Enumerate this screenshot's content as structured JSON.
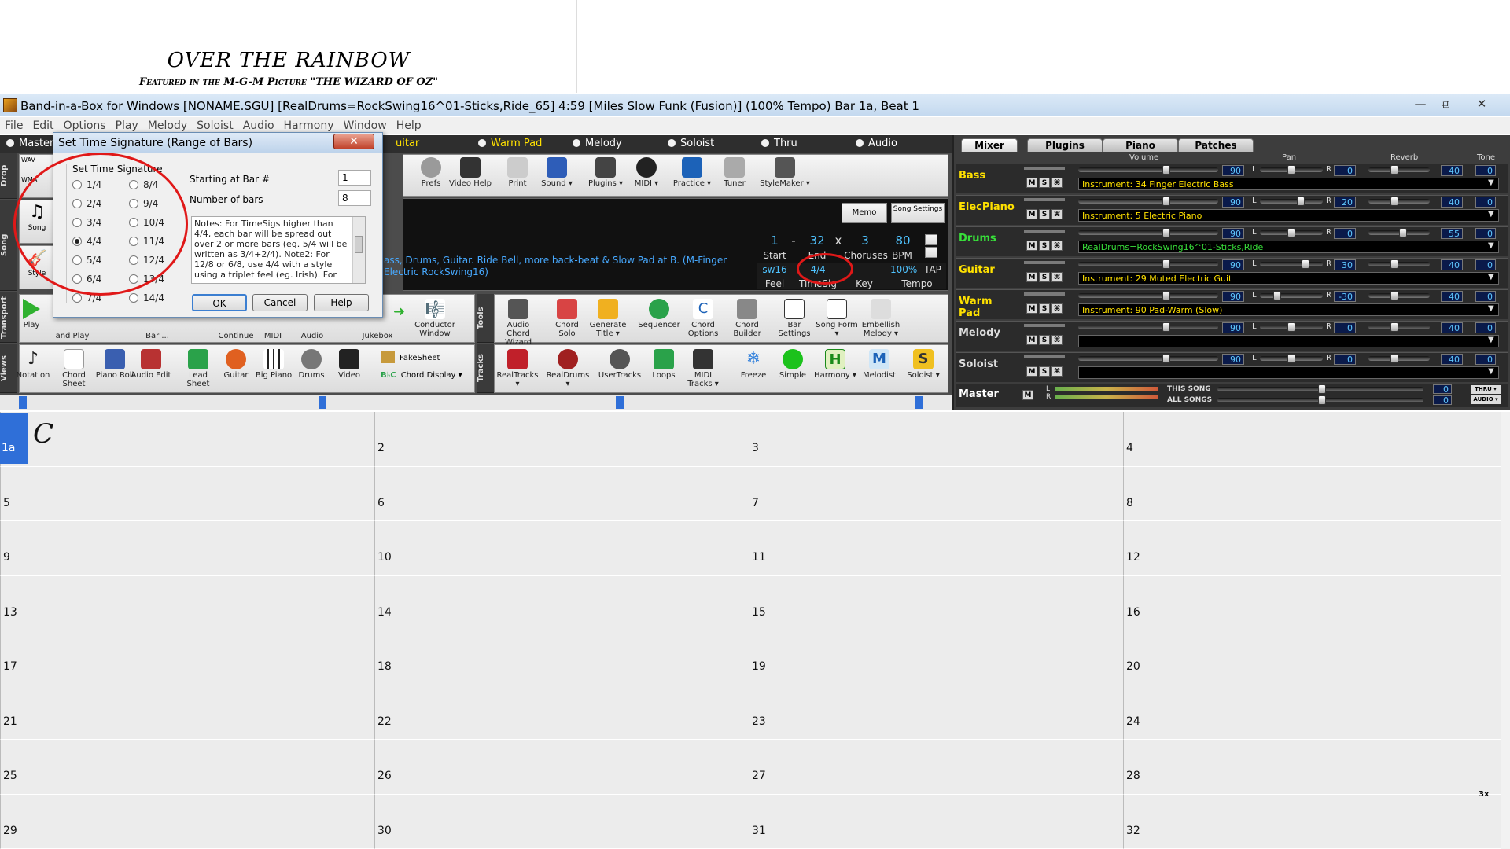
{
  "sheet": {
    "title": "OVER THE RAINBOW",
    "subtitle": "Featured in the M-G-M Picture \"THE WIZARD OF OZ\""
  },
  "window": {
    "title": "Band-in-a-Box for Windows  [NONAME.SGU] [RealDrums=RockSwing16^01-Sticks,Ride_65]  4:59  [Miles Slow Funk (Fusion)] (100% Tempo)  Bar 1a, Beat 1",
    "minimize": "—",
    "restore": "⧉",
    "close": "✕"
  },
  "menu": [
    "File",
    "Edit",
    "Options",
    "Play",
    "Melody",
    "Soloist",
    "Audio",
    "Harmony",
    "Window",
    "Help"
  ],
  "tracks": [
    {
      "label": "Master"
    },
    {
      "label": "uitar"
    },
    {
      "label": "Warm Pad"
    },
    {
      "label": "Melody"
    },
    {
      "label": "Soloist"
    },
    {
      "label": "Thru"
    },
    {
      "label": "Audio"
    }
  ],
  "side_labels": {
    "drop": "Drop",
    "song": "Song",
    "transport": "Transport",
    "views": "Views",
    "tools": "Tools",
    "tracks": "Tracks"
  },
  "left_tools": {
    "wav": "WAV",
    "wma": "WMA",
    "song": "Song",
    "style": "Style",
    "play": "Play",
    "and_play": "and Play",
    "bar": "Bar ...",
    "continue": "Continue",
    "midi": "MIDI",
    "audio": "Audio",
    "jukebox": "Jukebox"
  },
  "toolbar_top": [
    {
      "label": "Prefs"
    },
    {
      "label": "Video Help"
    },
    {
      "label": "Print"
    },
    {
      "label": "Sound ▾"
    },
    {
      "label": "Plugins ▾"
    },
    {
      "label": "MIDI ▾"
    },
    {
      "label": "Practice ▾"
    },
    {
      "label": "Tuner"
    },
    {
      "label": "StyleMaker ▾"
    }
  ],
  "memo": "Memo",
  "song_settings": "Song Settings",
  "style_desc": "ass, Drums, Guitar. Ride Bell, more back-beat & Slow Pad at B.   (M-Finger Electric RockSwing16)",
  "song_info": {
    "start": "1",
    "dash": "-",
    "end": "32",
    "x": "x",
    "choruses": "3",
    "start_label": "Start",
    "end_label": "End",
    "choruses_label": "Choruses",
    "bpm": "80",
    "bpm_label": "BPM",
    "tempo_pct": "100%",
    "tap": "TAP",
    "tempo_label": "Tempo",
    "feel": "sw16",
    "feel_label": "Feel",
    "timesig": "4/4",
    "timesig_label": "TimeSig",
    "key_label": "Key"
  },
  "conductor": "Conductor Window",
  "tools_row": [
    {
      "label": "Audio Chord Wizard"
    },
    {
      "label": "Chord Solo"
    },
    {
      "label": "Generate Title ▾"
    },
    {
      "label": "Sequencer"
    },
    {
      "label": "Chord Options"
    },
    {
      "label": "Chord Builder"
    },
    {
      "label": "Bar Settings"
    },
    {
      "label": "Song Form ▾"
    },
    {
      "label": "Embellish Melody ▾"
    }
  ],
  "views_row": [
    {
      "label": "Notation"
    },
    {
      "label": "Chord Sheet"
    },
    {
      "label": "Piano Roll"
    },
    {
      "label": "Audio Edit"
    },
    {
      "label": "Lead Sheet"
    },
    {
      "label": "Guitar"
    },
    {
      "label": "Big Piano"
    },
    {
      "label": "Drums"
    },
    {
      "label": "Video"
    }
  ],
  "fakesheet": "FakeSheet",
  "chord_display": "Chord Display ▾",
  "tracks_row": [
    {
      "label": "RealTracks ▾"
    },
    {
      "label": "RealDrums ▾"
    },
    {
      "label": "UserTracks"
    },
    {
      "label": "Loops"
    },
    {
      "label": "MIDI Tracks ▾"
    },
    {
      "label": "Freeze"
    },
    {
      "label": "Simple"
    },
    {
      "label": "Harmony ▾"
    },
    {
      "label": "Melodist"
    },
    {
      "label": "Soloist ▾"
    }
  ],
  "mixer": {
    "tabs": [
      "Mixer",
      "Plugins",
      "Piano",
      "Patches"
    ],
    "headers": {
      "volume": "Volume",
      "pan": "Pan",
      "reverb": "Reverb",
      "tone": "Tone"
    },
    "rows": [
      {
        "name": "Bass",
        "color": "#ffe100",
        "vol": "90",
        "pan": "0",
        "rev": "40",
        "tone": "0",
        "inst": "Instrument: 34 Finger Electric Bass",
        "inst_color": "#ffe100"
      },
      {
        "name": "ElecPiano",
        "color": "#ffe100",
        "vol": "90",
        "pan": "20",
        "rev": "40",
        "tone": "0",
        "inst": "Instrument: 5 Electric Piano",
        "inst_color": "#ffe100"
      },
      {
        "name": "Drums",
        "color": "#38e03a",
        "vol": "90",
        "pan": "0",
        "rev": "55",
        "tone": "0",
        "inst": "RealDrums=RockSwing16^01-Sticks,Ride",
        "inst_color": "#38e03a"
      },
      {
        "name": "Guitar",
        "color": "#ffe100",
        "vol": "90",
        "pan": "30",
        "rev": "40",
        "tone": "0",
        "inst": "Instrument: 29 Muted Electric Guit",
        "inst_color": "#ffe100"
      },
      {
        "name": "Warm Pad",
        "color": "#ffe100",
        "vol": "90",
        "pan": "-30",
        "rev": "40",
        "tone": "0",
        "inst": "Instrument: 90 Pad-Warm (Slow)",
        "inst_color": "#ffe100"
      },
      {
        "name": "Melody",
        "color": "#dddddd",
        "vol": "90",
        "pan": "0",
        "rev": "40",
        "tone": "0",
        "inst": "",
        "inst_color": "#dddddd"
      },
      {
        "name": "Soloist",
        "color": "#dddddd",
        "vol": "90",
        "pan": "0",
        "rev": "40",
        "tone": "0",
        "inst": "",
        "inst_color": "#dddddd"
      }
    ],
    "master": "Master",
    "this_song": "THIS SONG",
    "all_songs": "ALL SONGS",
    "thru": "THRU ▾",
    "audio": "AUDIO ▾",
    "msr": [
      "M",
      "S",
      "⌘"
    ],
    "L": "L",
    "R": "R"
  },
  "grid": {
    "bars": [
      "1a",
      "2",
      "3",
      "4",
      "5",
      "6",
      "7",
      "8",
      "9",
      "10",
      "11",
      "12",
      "13",
      "14",
      "15",
      "16",
      "17",
      "18",
      "19",
      "20",
      "21",
      "22",
      "23",
      "24",
      "25",
      "26",
      "27",
      "28",
      "29",
      "30",
      "31",
      "32"
    ],
    "first_chord": "C",
    "repeat_mark": "3x"
  },
  "dialog": {
    "title": "Set Time Signature (Range of Bars)",
    "close": "✕",
    "group_label": "Set Time Signature",
    "options_left": [
      "1/4",
      "2/4",
      "3/4",
      "4/4",
      "5/4",
      "6/4",
      "7/4"
    ],
    "options_right": [
      "8/4",
      "9/4",
      "10/4",
      "11/4",
      "12/4",
      "13/4",
      "14/4"
    ],
    "selected": "4/4",
    "start_label": "Starting at Bar #",
    "start_value": "1",
    "count_label": "Number of bars",
    "count_value": "8",
    "notes": "Notes: For TimeSigs higher than 4/4, each bar will be spread out over 2 or more bars (eg. 5/4 will be written as 3/4+2/4). Note2: For 12/8 or 6/8, use 4/4 with a style using a triplet feel (eg. Irish). For",
    "ok": "OK",
    "cancel": "Cancel",
    "help": "Help"
  }
}
